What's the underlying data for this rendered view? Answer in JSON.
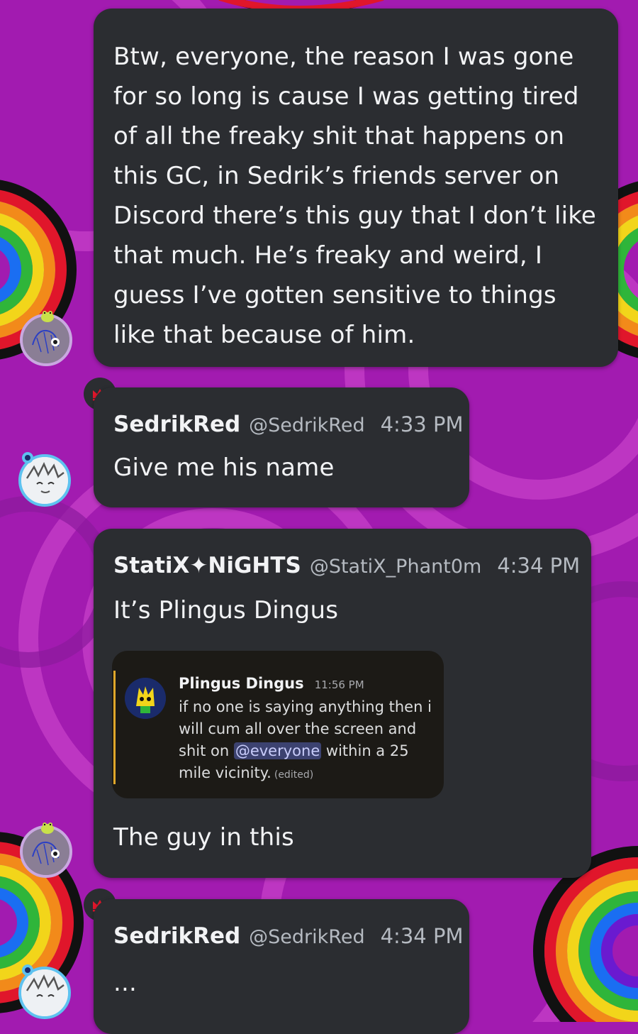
{
  "messages": [
    {
      "text": "Btw, everyone, the reason I was gone for so long is cause I was getting tired of all the freaky shit that happens on this GC, in Sedrik’s friends server on Discord there’s this guy that I don’t like that much. He’s freaky and weird, I guess I’ve gotten sensitive to things like that because of him."
    },
    {
      "author": "SedrikRed",
      "handle": "@SedrikRed",
      "time": "4:33 PM",
      "text": "Give me his name"
    },
    {
      "author": "StatiX✦NiGHTS",
      "handle": "@StatiX_Phant0m",
      "time": "4:34 PM",
      "text": "It’s Plingus Dingus",
      "caption": "The guy in this",
      "quoted": {
        "author": "Plingus Dingus",
        "time": "11:56 PM",
        "text_before": "if no one is saying anything then i will cum all over the screen and shit on ",
        "mention": "@everyone",
        "text_after": " within a 25 mile vicinity.",
        "edited": "(edited)"
      }
    },
    {
      "author": "SedrikRed",
      "handle": "@SedrikRed",
      "time": "4:34 PM",
      "text": "..."
    }
  ],
  "icons": {
    "crown": "crown-icon",
    "accent_crown_color": "#e0162b",
    "mention_color": "#5865f2",
    "quote_bar_color": "#e0a72a"
  }
}
